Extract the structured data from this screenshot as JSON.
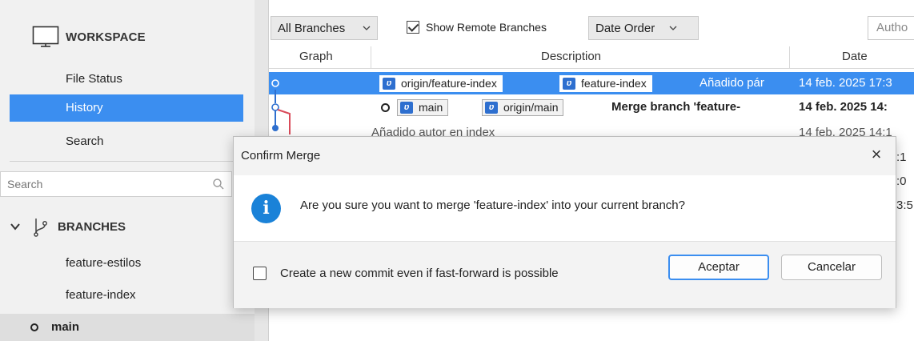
{
  "sidebar": {
    "workspace_label": "WORKSPACE",
    "nav": [
      {
        "label": "File Status"
      },
      {
        "label": "History"
      },
      {
        "label": "Search"
      }
    ],
    "search_placeholder": "Search",
    "branches_label": "BRANCHES",
    "branches": [
      "feature-estilos",
      "feature-index"
    ],
    "current_branch": "main"
  },
  "toolbar": {
    "branches_filter": "All Branches",
    "show_remote_label": "Show Remote Branches",
    "show_remote_checked": true,
    "order": "Date Order",
    "author_placeholder": "Autho"
  },
  "columns": {
    "graph": "Graph",
    "description": "Description",
    "date": "Date"
  },
  "commits": [
    {
      "tags": [
        "origin/feature-index",
        "feature-index"
      ],
      "description": "Añadido pár",
      "date": "14 feb. 2025 17:3"
    },
    {
      "tags": [
        "main",
        "origin/main"
      ],
      "description": "Merge branch 'feature-",
      "date": "14 feb. 2025 14:"
    },
    {
      "tags": [],
      "description": "Añadido autor en index",
      "date": "14 feb. 2025 14:1"
    }
  ],
  "hidden_dates": [
    ":1",
    ":0",
    "3:5"
  ],
  "dialog": {
    "title": "Confirm Merge",
    "close_glyph": "×",
    "message": "Are you sure you want to merge 'feature-index' into your current branch?",
    "checkbox_label": "Create a new commit even if fast-forward is possible",
    "checkbox_checked": false,
    "accept_label": "Aceptar",
    "cancel_label": "Cancelar"
  },
  "colors": {
    "accent": "#3b8ef0",
    "info_icon": "#1a82d8",
    "branch_badge": "#2e6fcf",
    "graph_red": "#d94b5a"
  },
  "icons": {
    "workspace": "monitor-icon",
    "branches": "branch-icon",
    "search": "search-icon",
    "info": "info-icon",
    "close": "close-icon"
  }
}
